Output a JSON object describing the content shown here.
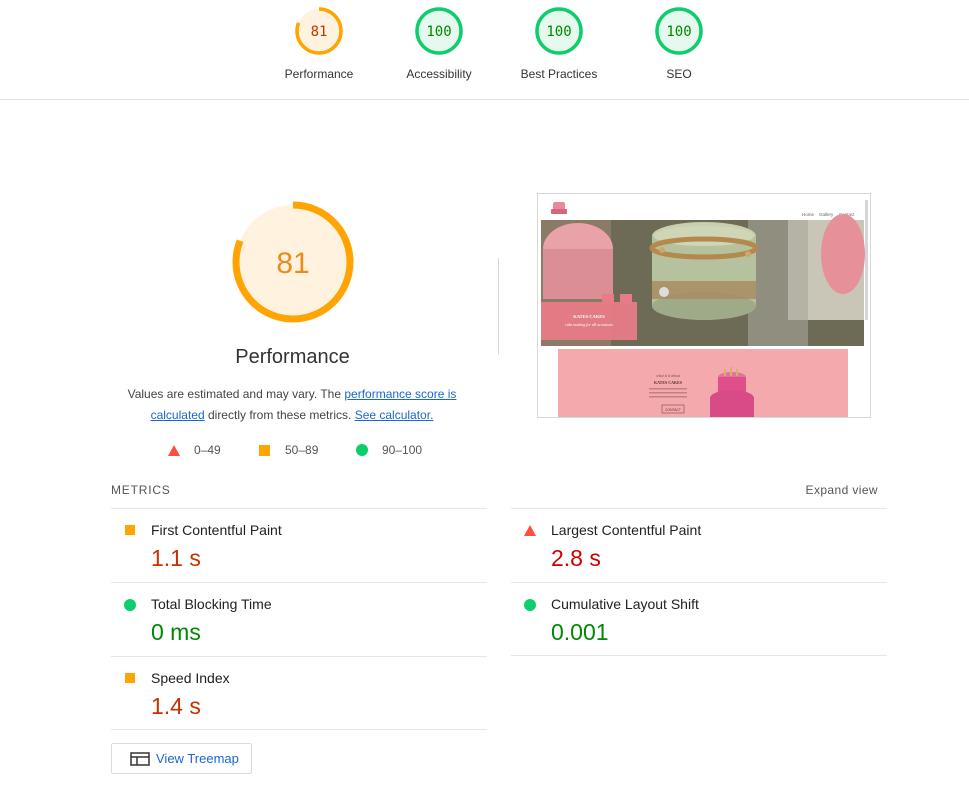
{
  "colors": {
    "average": "#ffa400",
    "average_text": "#c33300",
    "pass": "#0cce6b",
    "pass_text": "#008800",
    "fail": "#ff4e42",
    "fail_text": "#cc0000",
    "link": "#1967d2"
  },
  "category_gauges": [
    {
      "score": "81",
      "label": "Performance",
      "rating": "average",
      "fraction": 0.81
    },
    {
      "score": "100",
      "label": "Accessibility",
      "rating": "pass",
      "fraction": 1.0
    },
    {
      "score": "100",
      "label": "Best Practices",
      "rating": "pass",
      "fraction": 1.0
    },
    {
      "score": "100",
      "label": "SEO",
      "rating": "pass",
      "fraction": 1.0
    }
  ],
  "main_gauge": {
    "score": "81",
    "fraction": 0.81,
    "title": "Performance"
  },
  "description": {
    "text1": "Values are estimated and may vary. The ",
    "link1": "performance score is calculated",
    "text2": " directly from these metrics. ",
    "link2": "See calculator."
  },
  "legend": [
    {
      "range": "0–49",
      "shape": "triangle-icon",
      "rating": "fail"
    },
    {
      "range": "50–89",
      "shape": "square-icon",
      "rating": "average"
    },
    {
      "range": "90–100",
      "shape": "circle-icon",
      "rating": "pass"
    }
  ],
  "screenshot": {
    "nav_items": [
      "Home",
      "Gallery",
      "Contact"
    ],
    "hero_title": "KATES CAKES",
    "hero_tagline": "cake making for all occasions",
    "about_heading": "what is it about",
    "about_title": "KATES CAKES",
    "about_button": "CONTACT"
  },
  "metrics": {
    "heading": "METRICS",
    "expand_label": "Expand view",
    "items": [
      {
        "label": "First Contentful Paint",
        "value": "1.1 s",
        "rating": "average"
      },
      {
        "label": "Largest Contentful Paint",
        "value": "2.8 s",
        "rating": "fail"
      },
      {
        "label": "Total Blocking Time",
        "value": "0 ms",
        "rating": "pass"
      },
      {
        "label": "Cumulative Layout Shift",
        "value": "0.001",
        "rating": "pass"
      },
      {
        "label": "Speed Index",
        "value": "1.4 s",
        "rating": "average"
      }
    ]
  },
  "treemap_button": "View Treemap"
}
